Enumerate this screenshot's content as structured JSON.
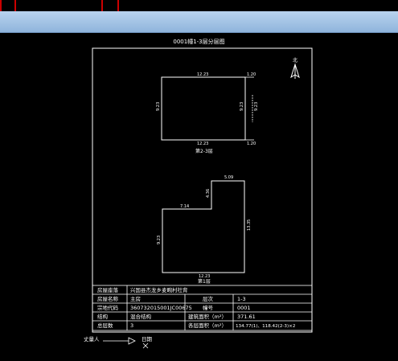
{
  "window": {
    "title": "0001幢1-3层分层图"
  },
  "plan_upper": {
    "label": "第2-3层",
    "dims": {
      "top": "12.23",
      "bottom": "12.23",
      "left": "9.23",
      "right_outer": "9.23",
      "right_inner": "9.23",
      "corner_top": "1.20",
      "corner_bottom": "1.20"
    }
  },
  "plan_lower": {
    "label": "第1层",
    "dims": {
      "top_left": "7.14",
      "top_right": "5.09",
      "step": "4.36",
      "left": "9.23",
      "right": "13.35",
      "bottom": "12.23"
    }
  },
  "north_label": "北",
  "table": {
    "rows": [
      [
        "房屋座落",
        "兴国县杰龙乡麦畹村社背",
        "",
        ""
      ],
      [
        "房屋名称",
        "主房",
        "层次",
        "1-3"
      ],
      [
        "宗地代码",
        "360732015001JC00675",
        "幢号",
        "0001"
      ],
      [
        "结构",
        "混合结构",
        "建筑面积（m²）",
        "371.61"
      ],
      [
        "总层数",
        "3",
        "各层面积（m²）",
        "134.77(1)、118.42(2-3)×2"
      ]
    ]
  },
  "footer": {
    "mapper": "丈量人",
    "date": "日期"
  }
}
